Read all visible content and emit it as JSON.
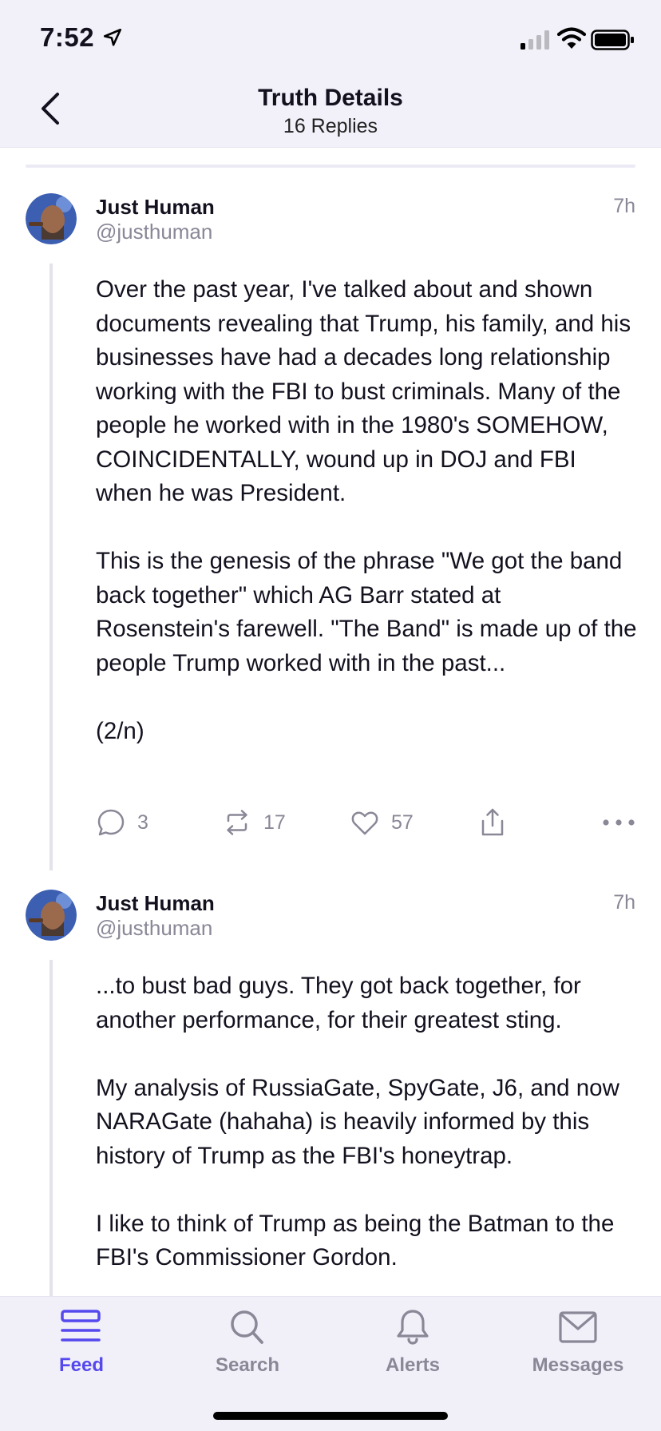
{
  "status_bar": {
    "time": "7:52"
  },
  "header": {
    "title": "Truth Details",
    "subtitle": "16 Replies",
    "back_label": "Back"
  },
  "posts": [
    {
      "author": "Just Human",
      "handle": "@justhuman",
      "time": "7h",
      "paragraphs": [
        "Over the past year, I've talked about and shown documents revealing that Trump, his family, and his businesses have had a decades long relationship working with the FBI to bust criminals. Many of the people he worked with in the 1980's SOMEHOW, COINCIDENTALLY, wound up in DOJ and FBI when he was President.",
        "This is the genesis of the phrase \"We got the band back together\" which AG Barr stated at Rosenstein's farewell. \"The Band\" is made up of the people Trump worked with in the past...",
        "(2/n)"
      ],
      "replies": "3",
      "retruths": "17",
      "likes": "57"
    },
    {
      "author": "Just Human",
      "handle": "@justhuman",
      "time": "7h",
      "paragraphs": [
        "...to bust bad guys. They got back together, for another performance, for their greatest sting.",
        "My analysis of RussiaGate, SpyGate, J6, and now NARAGate (hahaha) is heavily informed by this history of Trump as the FBI's honeytrap.",
        "I like to think of Trump as being the Batman to the FBI's Commissioner Gordon."
      ]
    }
  ],
  "tabbar": {
    "feed": "Feed",
    "search": "Search",
    "alerts": "Alerts",
    "messages": "Messages"
  },
  "colors": {
    "accent": "#5448ee",
    "muted": "#8a8797",
    "text": "#14111f"
  },
  "icons": {
    "status": [
      "location-arrow-icon",
      "cellular-signal-icon",
      "wifi-icon",
      "battery-icon"
    ],
    "header": "chevron-left-icon",
    "actions": [
      "comment-icon",
      "retruth-icon",
      "heart-icon",
      "share-icon",
      "more-icon"
    ],
    "tabs": [
      "feed-icon",
      "search-icon",
      "bell-icon",
      "envelope-icon"
    ]
  }
}
